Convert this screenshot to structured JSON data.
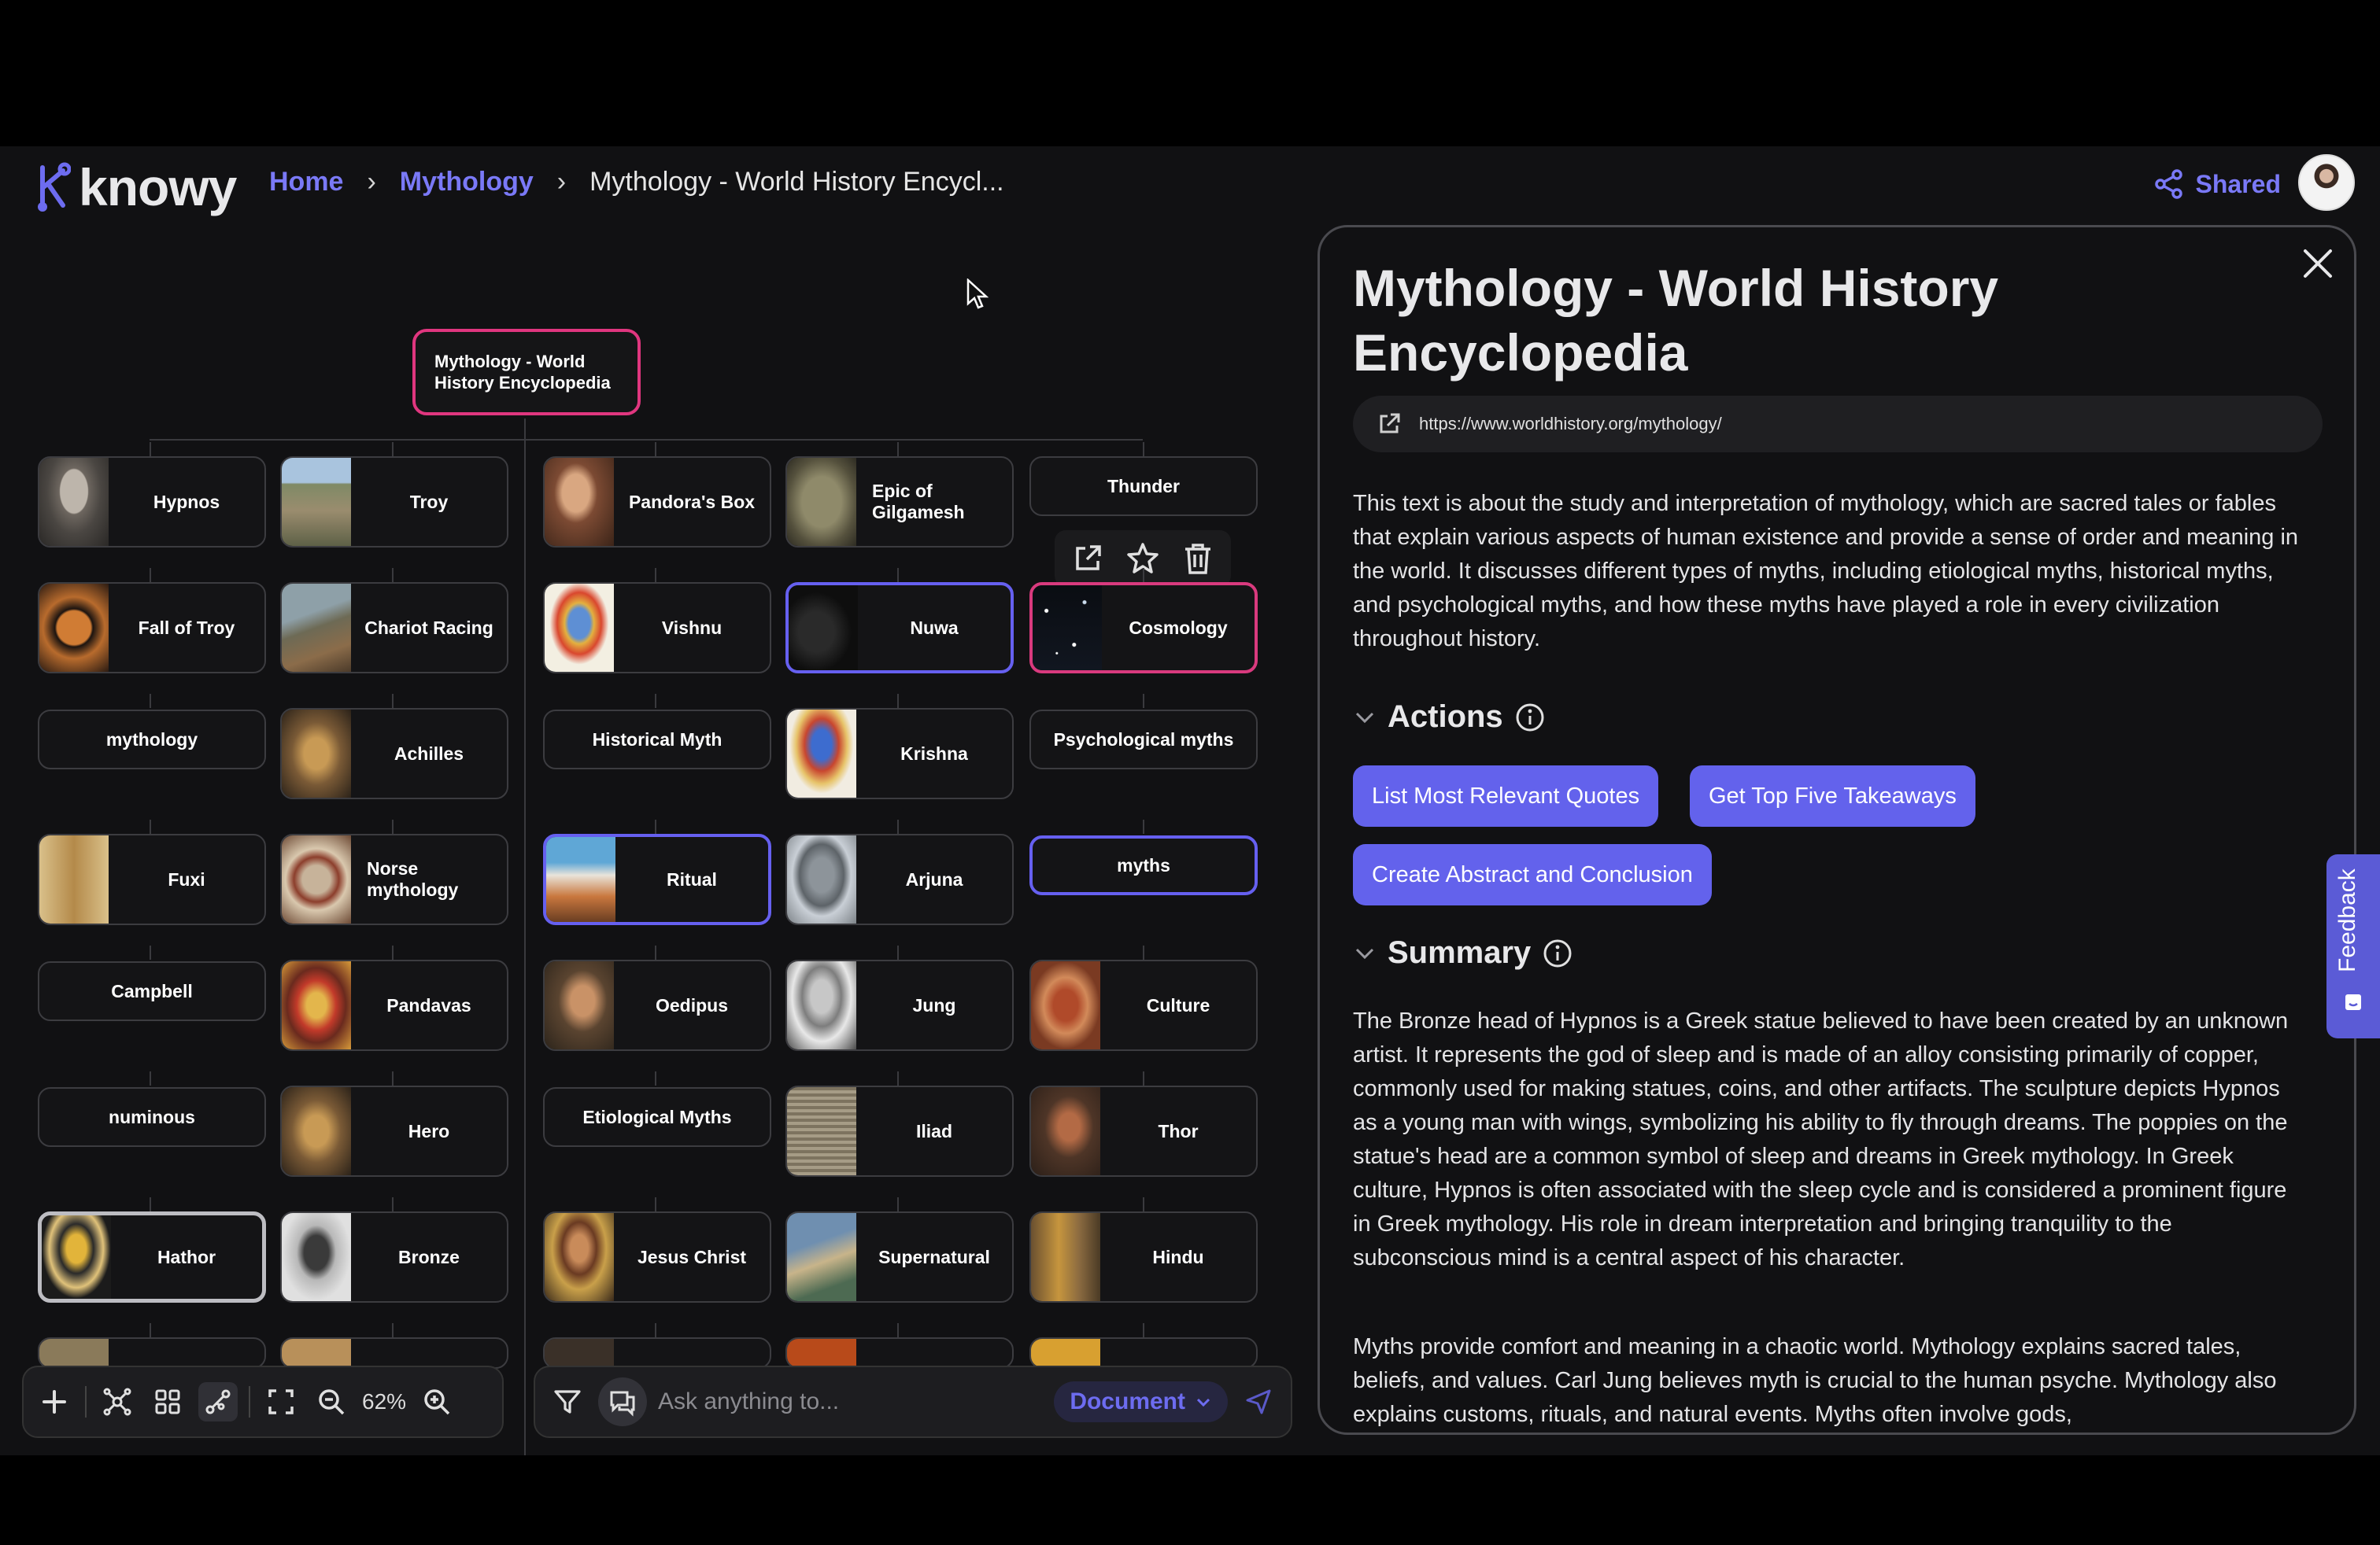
{
  "app": {
    "name": "knowy"
  },
  "breadcrumb": {
    "home": "Home",
    "category": "Mythology",
    "current": "Mythology - World History Encycl..."
  },
  "header": {
    "share_label": "Shared"
  },
  "canvas": {
    "root": "Mythology - World History Encyclopedia",
    "nodes": {
      "hypnos": "Hypnos",
      "troy": "Troy",
      "pandoras_box": "Pandora's Box",
      "epic_gilgamesh": "Epic of Gilgamesh",
      "thunder": "Thunder",
      "fall_of_troy": "Fall of Troy",
      "chariot_racing": "Chariot Racing",
      "vishnu": "Vishnu",
      "nuwa": "Nuwa",
      "cosmology": "Cosmology",
      "mythology": "mythology",
      "achilles": "Achilles",
      "historical_myth": "Historical Myth",
      "krishna": "Krishna",
      "psychological_myths": "Psychological myths",
      "fuxi": "Fuxi",
      "norse_mythology": "Norse mythology",
      "ritual": "Ritual",
      "arjuna": "Arjuna",
      "myths": "myths",
      "campbell": "Campbell",
      "pandavas": "Pandavas",
      "oedipus": "Oedipus",
      "jung": "Jung",
      "culture": "Culture",
      "numinous": "numinous",
      "hero": "Hero",
      "etiological_myths": "Etiological Myths",
      "iliad": "Iliad",
      "thor": "Thor",
      "hathor": "Hathor",
      "bronze": "Bronze",
      "jesus_christ": "Jesus Christ",
      "supernatural": "Supernatural",
      "hindu": "Hindu"
    }
  },
  "toolbar": {
    "zoom": "62%"
  },
  "ask": {
    "placeholder": "Ask anything to...",
    "scope": "Document"
  },
  "panel": {
    "title": "Mythology - World History Encyclopedia",
    "url": "https://www.worldhistory.org/mythology/",
    "description": "This text is about the study and interpretation of mythology, which are sacred tales or fables that explain various aspects of human existence and provide a sense of order and meaning in the world. It discusses different types of myths, including etiological myths, historical myths, and psychological myths, and how these myths have played a role in every civilization throughout history.",
    "actions_heading": "Actions",
    "actions": [
      "List Most Relevant Quotes",
      "Get Top Five Takeaways",
      "Create Abstract and Conclusion"
    ],
    "summary_heading": "Summary",
    "summary_p1": "The Bronze head of Hypnos is a Greek statue believed to have been created by an unknown artist. It represents the god of sleep and is made of an alloy consisting primarily of copper, commonly used for making statues, coins, and other artifacts. The sculpture depicts Hypnos as a young man with wings, symbolizing his ability to fly through dreams. The poppies on the statue's head are a common symbol of sleep and dreams in Greek mythology. In Greek culture, Hypnos is often associated with the sleep cycle and is considered a prominent figure in Greek mythology. His role in dream interpretation and bringing tranquility to the subconscious mind is a central aspect of his character.",
    "summary_p2": "Myths provide comfort and meaning in a chaotic world. Mythology explains sacred tales, beliefs, and values. Carl Jung believes myth is crucial to the human psyche. Mythology also explains customs, rituals, and natural events. Myths often involve gods,"
  },
  "feedback_label": "Feedback",
  "colors": {
    "accent": "#6362ec",
    "link": "#7a79f7",
    "highlight_pink": "#e0367f",
    "background": "#111113"
  }
}
